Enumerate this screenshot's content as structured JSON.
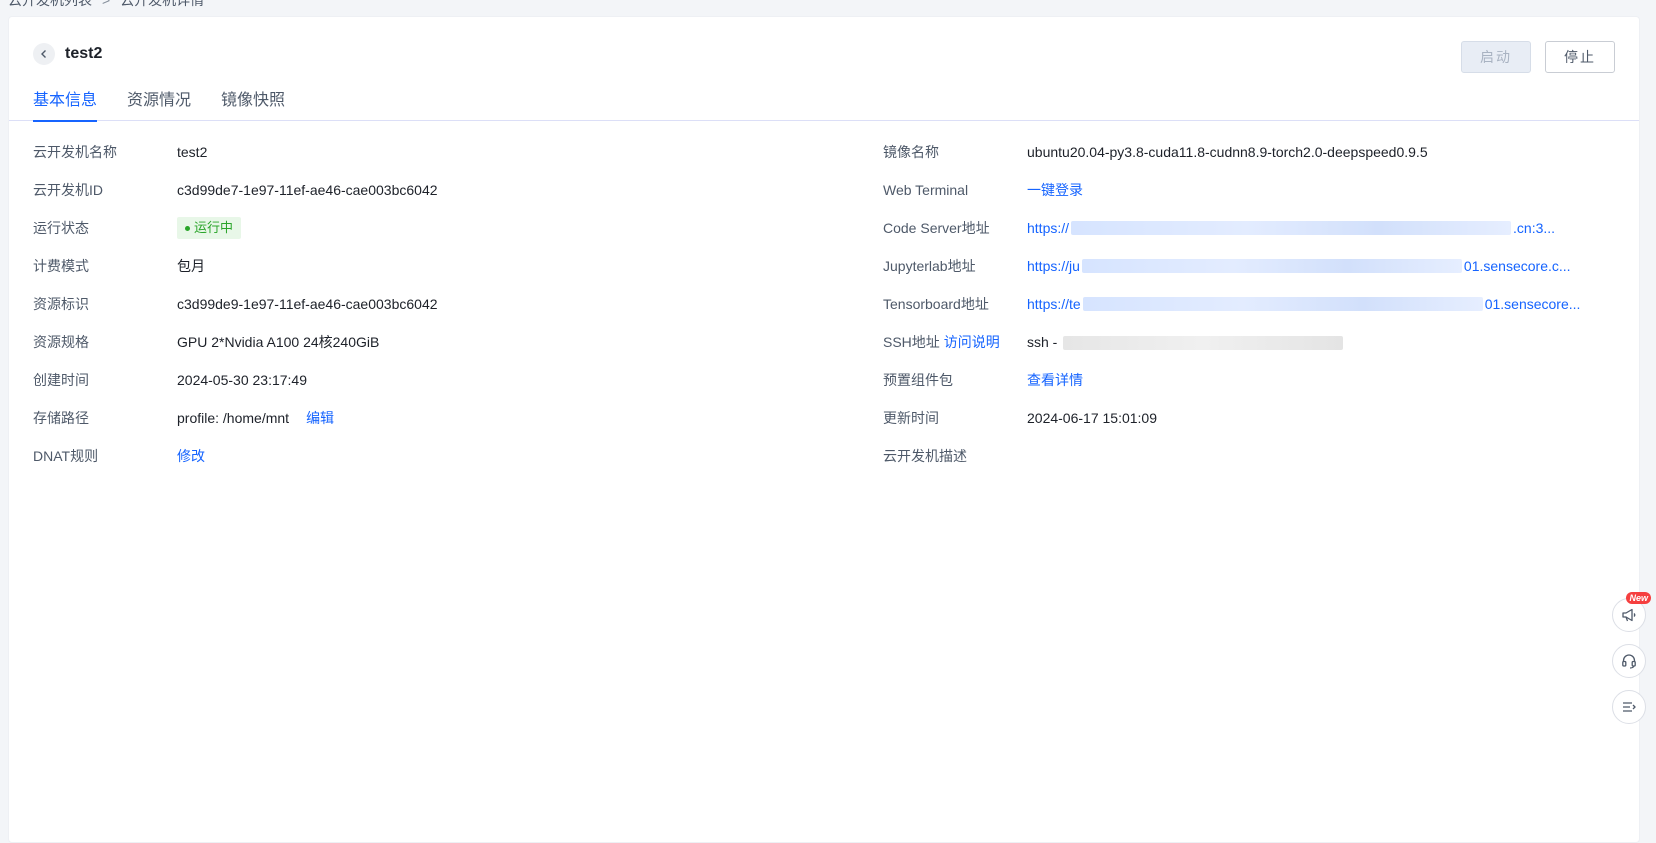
{
  "breadcrumb": {
    "parent": "云开发机列表",
    "separator": ">",
    "current": "云开发机详情"
  },
  "header": {
    "title": "test2"
  },
  "actions": {
    "start_label": "启动",
    "stop_label": "停止"
  },
  "tabs": [
    {
      "label": "基本信息",
      "active": true
    },
    {
      "label": "资源情况",
      "active": false
    },
    {
      "label": "镜像快照",
      "active": false
    }
  ],
  "left": {
    "name": {
      "label": "云开发机名称",
      "value": "test2"
    },
    "id": {
      "label": "云开发机ID",
      "value": "c3d99de7-1e97-11ef-ae46-cae003bc6042"
    },
    "status": {
      "label": "运行状态",
      "value": "运行中"
    },
    "billing": {
      "label": "计费模式",
      "value": "包月"
    },
    "resource_id": {
      "label": "资源标识",
      "value": "c3d99de9-1e97-11ef-ae46-cae003bc6042"
    },
    "spec": {
      "label": "资源规格",
      "value": "GPU 2*Nvidia A100 24核240GiB"
    },
    "created": {
      "label": "创建时间",
      "value": "2024-05-30 23:17:49"
    },
    "storage": {
      "label": "存储路径",
      "value": "profile: /home/mnt",
      "edit": "编辑"
    },
    "dnat": {
      "label": "DNAT规则",
      "action": "修改"
    }
  },
  "right": {
    "image": {
      "label": "镜像名称",
      "value": "ubuntu20.04-py3.8-cuda11.8-cudnn8.9-torch2.0-deepspeed0.9.5"
    },
    "terminal": {
      "label": "Web Terminal",
      "action": "一键登录"
    },
    "code_server": {
      "label": "Code Server地址",
      "prefix": "https://",
      "suffix": ".cn:3..."
    },
    "jupyter": {
      "label": "Jupyterlab地址",
      "prefix": "https://ju",
      "suffix": "01.sensecore.c..."
    },
    "tensorboard": {
      "label": "Tensorboard地址",
      "prefix": "https://te",
      "suffix": "01.sensecore..."
    },
    "ssh": {
      "label": "SSH地址",
      "help": "访问说明",
      "prefix": "ssh -"
    },
    "components": {
      "label": "预置组件包",
      "action": "查看详情"
    },
    "updated": {
      "label": "更新时间",
      "value": "2024-06-17 15:01:09"
    },
    "description": {
      "label": "云开发机描述",
      "value": ""
    }
  },
  "float": {
    "new_badge": "New"
  },
  "colors": {
    "accent": "#1664ff",
    "status_green": "#2aa52a",
    "badge_red": "#f53f3f"
  },
  "icons": [
    "chevron-left-icon",
    "megaphone-icon",
    "headset-icon",
    "menu-collapse-icon"
  ]
}
